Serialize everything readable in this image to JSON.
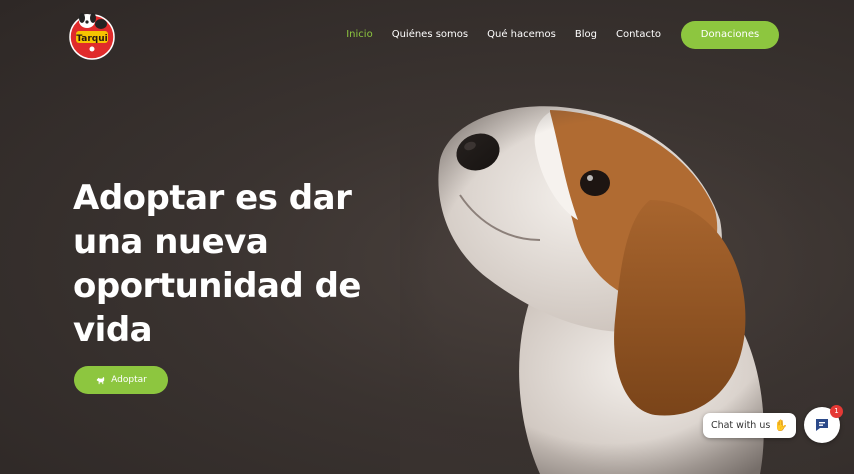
{
  "brand": {
    "logo_name": "Tarqui"
  },
  "nav": {
    "items": [
      {
        "label": "Inicio",
        "active": true
      },
      {
        "label": "Quiénes somos",
        "active": false
      },
      {
        "label": "Qué hacemos",
        "active": false
      },
      {
        "label": "Blog",
        "active": false
      },
      {
        "label": "Contacto",
        "active": false
      }
    ],
    "donate_label": "Donaciones"
  },
  "hero": {
    "title": "Adoptar es dar una nueva oportunidad de vida",
    "button_label": "Adoptar",
    "button_icon": "dog-icon"
  },
  "chat": {
    "label": "Chat with us",
    "emoji_icon": "wave-icon",
    "badge_count": "1"
  },
  "colors": {
    "accent": "#8dc63f",
    "background": "#3a3330",
    "badge": "#e53935"
  }
}
